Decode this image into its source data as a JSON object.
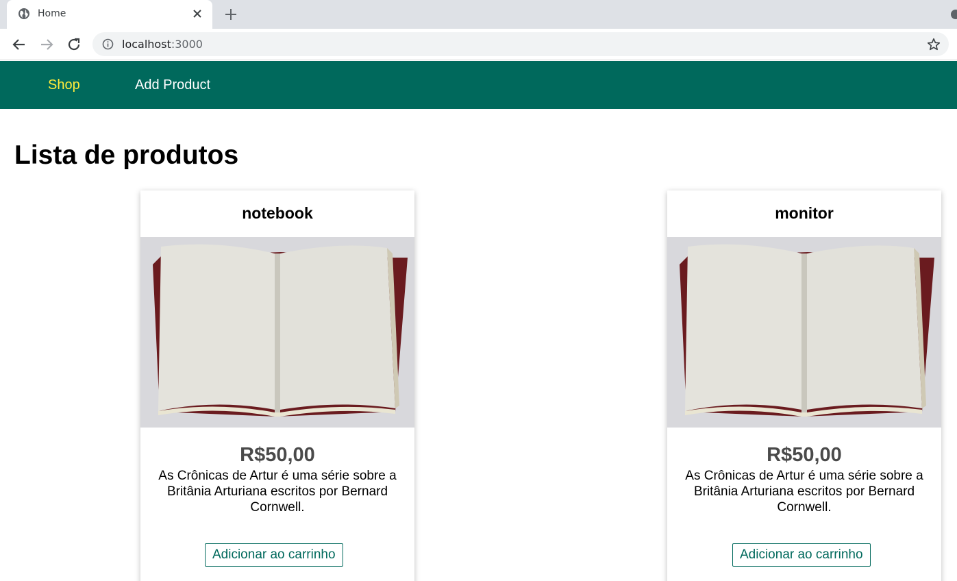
{
  "browser": {
    "tab_title": "Home",
    "url_host": "localhost",
    "url_port": ":3000"
  },
  "nav": {
    "shop_label": "Shop",
    "add_product_label": "Add Product"
  },
  "page": {
    "title": "Lista de produtos"
  },
  "products": [
    {
      "title": "notebook",
      "price": "R$50,00",
      "description": "As Crônicas de Artur é uma série sobre a Britânia Arturiana escritos por Bernard Cornwell.",
      "button_label": "Adicionar ao carrinho"
    },
    {
      "title": "monitor",
      "price": "R$50,00",
      "description": "As Crônicas de Artur é uma série sobre a Britânia Arturiana escritos por Bernard Cornwell.",
      "button_label": "Adicionar ao carrinho"
    }
  ],
  "colors": {
    "header_bg": "#00695c",
    "active_link": "#ffeb3b",
    "button_border": "#00695c"
  }
}
